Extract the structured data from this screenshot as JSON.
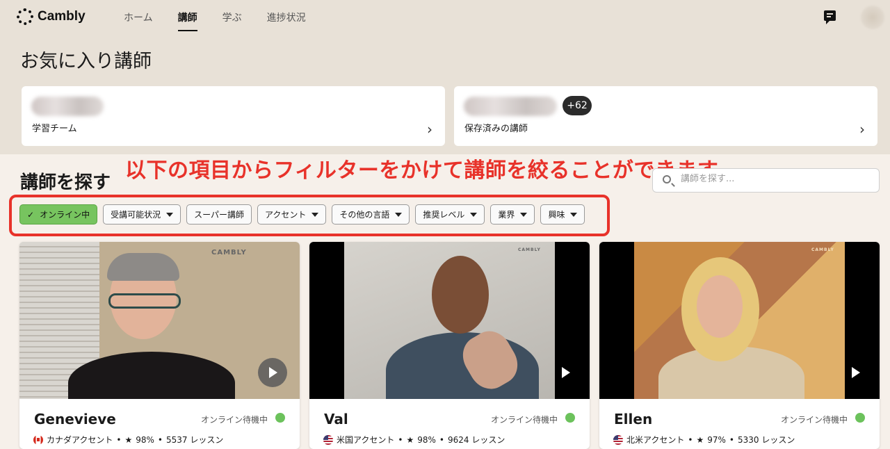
{
  "brand": {
    "name": "Cambly"
  },
  "nav": {
    "items": [
      "ホーム",
      "講師",
      "学ぶ",
      "進捗状況"
    ],
    "active": "講師"
  },
  "favorites": {
    "title": "お気に入り講師",
    "cards": [
      {
        "label": "学習チーム"
      },
      {
        "label": "保存済みの講師",
        "badge": "+62"
      }
    ]
  },
  "find": {
    "title": "講師を探す",
    "search_placeholder": "講師を探す...",
    "annotation": "以下の項目からフィルターをかけて講師を絞ることができます"
  },
  "filters": [
    {
      "label": "オンライン中",
      "active": true,
      "dropdown": false
    },
    {
      "label": "受講可能状況",
      "active": false,
      "dropdown": true
    },
    {
      "label": "スーパー講師",
      "active": false,
      "dropdown": false
    },
    {
      "label": "アクセント",
      "active": false,
      "dropdown": true
    },
    {
      "label": "その他の言語",
      "active": false,
      "dropdown": true
    },
    {
      "label": "推奨レベル",
      "active": false,
      "dropdown": true
    },
    {
      "label": "業界",
      "active": false,
      "dropdown": true
    },
    {
      "label": "興味",
      "active": false,
      "dropdown": true
    }
  ],
  "tutors": [
    {
      "name": "Genevieve",
      "status": "オンライン待機中",
      "flag": "ca",
      "accent": "カナダアクセント",
      "rating": "98%",
      "lessons": "5537 レッスン",
      "watermark": "CAMBLY"
    },
    {
      "name": "Val",
      "status": "オンライン待機中",
      "flag": "us",
      "accent": "米国アクセント",
      "rating": "98%",
      "lessons": "9624 レッスン",
      "watermark": "CAMBLY"
    },
    {
      "name": "Ellen",
      "status": "オンライン待機中",
      "flag": "us",
      "accent": "北米アクセント",
      "rating": "97%",
      "lessons": "5330 レッスン",
      "watermark": "CAMBLY"
    }
  ],
  "colors": {
    "online": "#6cc25c",
    "filter_active": "#77c45f",
    "annotation": "#e8322a"
  }
}
